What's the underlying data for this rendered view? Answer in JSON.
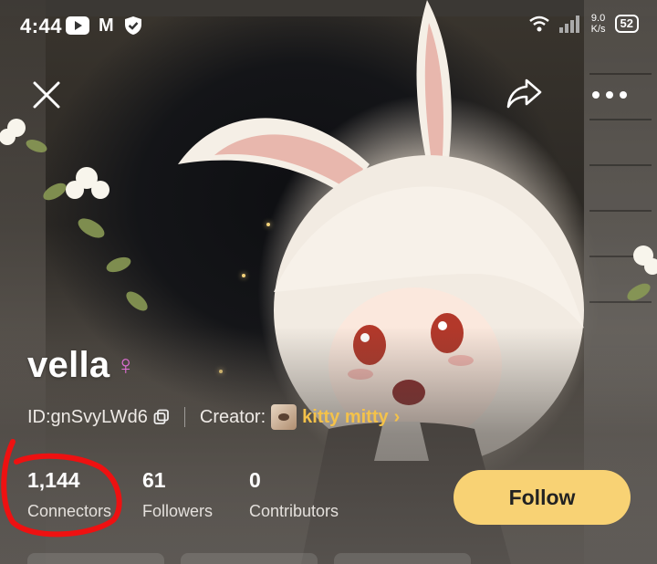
{
  "status_bar": {
    "time": "4:44",
    "network_speed_value": "9.0",
    "network_speed_unit": "K/s",
    "battery": "52"
  },
  "top_bar": {
    "close_icon": "close-icon",
    "share_icon": "share-icon",
    "more_icon": "more-icon"
  },
  "profile": {
    "name": "vella",
    "gender_symbol": "♀",
    "id_label": "ID:gnSvyLWd6",
    "creator_label": "Creator:",
    "creator_name": "kitty mitty"
  },
  "stats": [
    {
      "value": "1,144",
      "label": "Connectors"
    },
    {
      "value": "61",
      "label": "Followers"
    },
    {
      "value": "0",
      "label": "Contributors"
    }
  ],
  "actions": {
    "follow_label": "Follow"
  },
  "colors": {
    "follow_button": "#f8d274",
    "creator_name": "#f4c24a",
    "gender_symbol": "#e06fd4",
    "annotation_stroke": "#ee1111"
  }
}
